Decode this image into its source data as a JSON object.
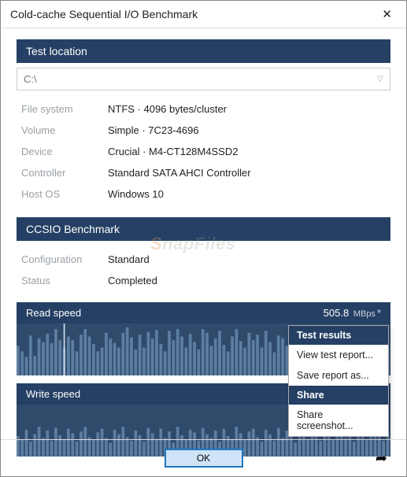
{
  "window": {
    "title": "Cold-cache Sequential I/O Benchmark"
  },
  "watermark": "SnapFiles",
  "location": {
    "header": "Test location",
    "path": "C:\\",
    "rows": [
      {
        "label": "File system",
        "value": "NTFS  ·  4096 bytes/cluster"
      },
      {
        "label": "Volume",
        "value": "Simple  ·  7C23-4696"
      },
      {
        "label": "Device",
        "value": "Crucial  ·  M4-CT128M4SSD2"
      },
      {
        "label": "Controller",
        "value": "Standard SATA AHCI Controller"
      },
      {
        "label": "Host OS",
        "value": "Windows 10"
      }
    ]
  },
  "benchmark": {
    "header": "CCSIO Benchmark",
    "rows": [
      {
        "label": "Configuration",
        "value": "Standard"
      },
      {
        "label": "Status",
        "value": "Completed"
      }
    ]
  },
  "read": {
    "label": "Read speed",
    "value": "505.8",
    "unit": "MBps",
    "ast": "*"
  },
  "write": {
    "label": "Write speed"
  },
  "footer": {
    "ok": "OK"
  },
  "popup": {
    "h1": "Test results",
    "i1": "View test report...",
    "i2": "Save report as...",
    "h2": "Share",
    "i3": "Share screenshot..."
  },
  "chart_data": [
    {
      "type": "bar",
      "title": "Read speed",
      "ylabel": "MBps",
      "ylim": [
        0,
        560
      ],
      "values": [
        320,
        260,
        200,
        430,
        210,
        400,
        360,
        450,
        350,
        500,
        380,
        300,
        420,
        380,
        260,
        440,
        500,
        420,
        340,
        260,
        300,
        460,
        400,
        350,
        300,
        460,
        520,
        410,
        280,
        440,
        300,
        470,
        400,
        490,
        340,
        260,
        480,
        380,
        500,
        420,
        300,
        450,
        360,
        280,
        500,
        460,
        320,
        400,
        480,
        330,
        260,
        420,
        500,
        370,
        300,
        460,
        380,
        440,
        300,
        480,
        360,
        250,
        430,
        400,
        320,
        480,
        350,
        290,
        460,
        440,
        300,
        500,
        380,
        270,
        450,
        320,
        480,
        400,
        290,
        440,
        360,
        500,
        310,
        270,
        460,
        390,
        480,
        350,
        300
      ]
    },
    {
      "type": "bar",
      "title": "Write speed",
      "ylabel": "MBps",
      "ylim": [
        0,
        560
      ],
      "values": [
        220,
        180,
        290,
        160,
        240,
        320,
        200,
        280,
        170,
        310,
        230,
        190,
        300,
        250,
        160,
        270,
        320,
        210,
        180,
        260,
        300,
        200,
        150,
        290,
        240,
        320,
        210,
        170,
        280,
        230,
        160,
        310,
        250,
        190,
        300,
        200,
        270,
        150,
        320,
        230,
        180,
        290,
        260,
        170,
        310,
        240,
        200,
        280,
        160,
        300,
        220,
        190,
        320,
        250,
        180,
        270,
        300,
        210,
        160,
        290,
        240,
        170,
        310,
        200,
        280,
        230,
        150,
        300,
        260,
        190,
        320,
        210,
        170,
        290,
        250,
        180,
        310,
        240,
        200,
        280,
        160,
        300,
        230,
        190,
        270,
        320,
        210,
        170,
        290
      ]
    }
  ]
}
